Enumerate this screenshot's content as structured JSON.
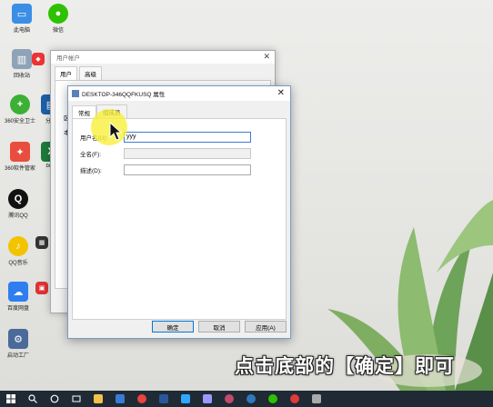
{
  "desktop_icons": [
    {
      "name": "此电脑",
      "color": "#3a8ee6",
      "glyph": "▭"
    },
    {
      "name": "微信",
      "color": "#2dc100",
      "glyph": "●"
    },
    {
      "name": "回收站",
      "color": "#8fa3b8",
      "glyph": "▥"
    },
    {
      "name": "",
      "color": "#e33",
      "glyph": "◆"
    },
    {
      "name": "360安全卫士",
      "color": "#3cb034",
      "glyph": "+"
    },
    {
      "name": "分析",
      "color": "#1d5fa8",
      "glyph": "▤"
    },
    {
      "name": "360软件管家",
      "color": "#e84d3d",
      "glyph": "✦"
    },
    {
      "name": "bike",
      "color": "#1d7a3a",
      "glyph": "X"
    },
    {
      "name": "腾讯QQ",
      "color": "#111",
      "glyph": "Q"
    },
    {
      "name": "QQ音乐",
      "color": "#f2c400",
      "glyph": "♪"
    },
    {
      "name": "",
      "color": "#333",
      "glyph": "▦"
    },
    {
      "name": "百度网盘",
      "color": "#2f7ef0",
      "glyph": "☁"
    },
    {
      "name": "",
      "color": "#d33",
      "glyph": "▣"
    },
    {
      "name": "启动工厂",
      "color": "#4a6a9a",
      "glyph": "⚙"
    }
  ],
  "back_window": {
    "title": "用户帐户",
    "close_glyph": "✕",
    "tabs": [
      "用户",
      "高级"
    ],
    "side_labels": [
      "区",
      "本"
    ]
  },
  "dialog": {
    "title": "DESKTOP-346QQFKUSQ 属性",
    "close_glyph": "✕",
    "tabs": [
      "常规",
      "组成员"
    ],
    "fields": [
      {
        "label": "用户名(U):",
        "value": "yyy"
      },
      {
        "label": "全名(F):",
        "value": ""
      },
      {
        "label": "描述(D):",
        "value": ""
      }
    ],
    "buttons": {
      "ok": "确定",
      "cancel": "取消",
      "apply": "应用(A)"
    }
  },
  "caption": "点击底部的【确定】即可",
  "taskbar": {
    "items": [
      {
        "name": "start",
        "color": "#ffffff"
      },
      {
        "name": "search",
        "color": "#ffffff"
      },
      {
        "name": "cortana",
        "color": "#ffffff"
      },
      {
        "name": "task-view",
        "color": "#ffffff"
      },
      {
        "name": "file-explorer",
        "color": "#f3c14a"
      },
      {
        "name": "store",
        "color": "#3a7bd5"
      },
      {
        "name": "chrome",
        "color": "#e8453c"
      },
      {
        "name": "word",
        "color": "#2b579a"
      },
      {
        "name": "photoshop",
        "color": "#31a8ff"
      },
      {
        "name": "premiere",
        "color": "#9999ff"
      },
      {
        "name": "davinci",
        "color": "#c04b6a"
      },
      {
        "name": "edge",
        "color": "#3277bc"
      },
      {
        "name": "wechat",
        "color": "#2dc100"
      },
      {
        "name": "record",
        "color": "#e03a3a"
      },
      {
        "name": "settings",
        "color": "#aaaaaa"
      }
    ]
  }
}
